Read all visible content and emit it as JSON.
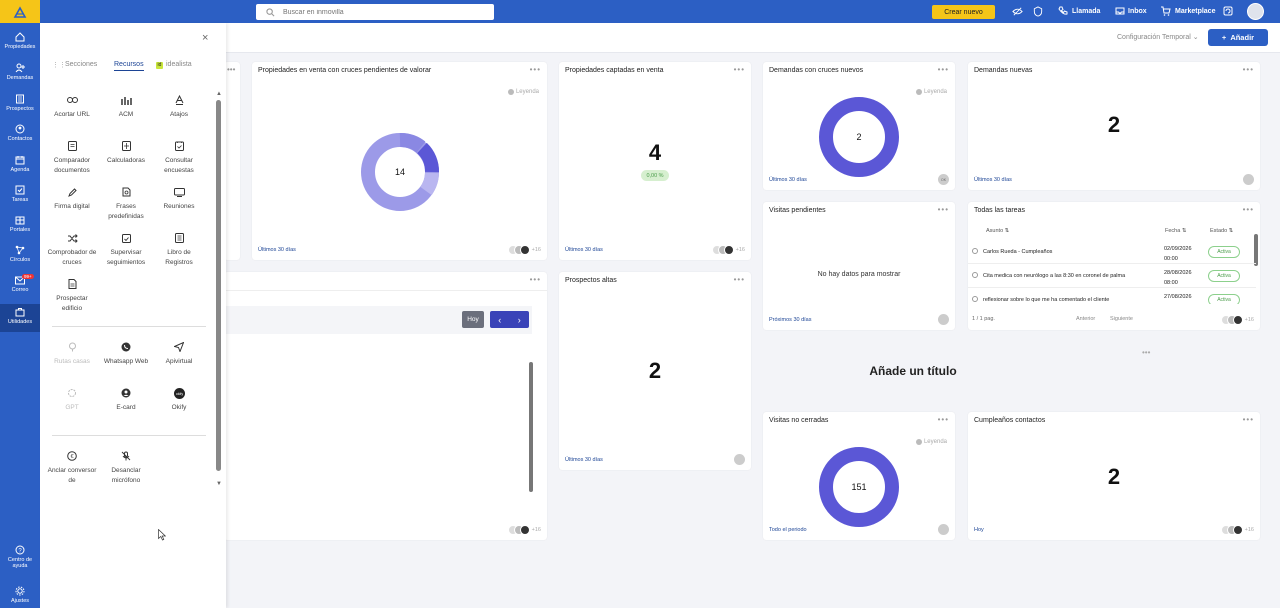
{
  "top": {
    "search_placeholder": "Buscar en inmovilla",
    "crear_label": "Crear nuevo",
    "llamada": "Llamada",
    "inbox": "Inbox",
    "marketplace": "Marketplace"
  },
  "sidebar": {
    "items": [
      {
        "label": "Propiedades"
      },
      {
        "label": "Demandas"
      },
      {
        "label": "Prospectos"
      },
      {
        "label": "Contactos"
      },
      {
        "label": "Agenda"
      },
      {
        "label": "Tareas"
      },
      {
        "label": "Portales"
      },
      {
        "label": "Círculos"
      },
      {
        "label": "Correo",
        "badge": "99+"
      },
      {
        "label": "Utilidades"
      }
    ],
    "help_label": "Centro de ayuda",
    "settings_label": "Ajustes"
  },
  "subheader": {
    "config_label": "Configuración Temporal",
    "add_label": "Añadir"
  },
  "panel": {
    "tabs": [
      "Secciones",
      "Recursos",
      "idealista"
    ],
    "tools_group1": [
      "Acortar URL",
      "ACM",
      "Atajos",
      "Comparador documentos",
      "Calculadoras",
      "Consultar encuestas",
      "Firma digital",
      "Frases predefinidas",
      "Reuniones",
      "Comprobador de cruces",
      "Supervisar seguimientos",
      "Libro de Registros",
      "Prospectar edificio"
    ],
    "tools_group2": [
      "Rutas casas",
      "Whatsapp Web",
      "Apivirtual",
      "GPT",
      "E-card",
      "Okify"
    ],
    "tools_group3": [
      "Anclar conversor de",
      "Desanclar micrófono"
    ]
  },
  "cards": {
    "cruces_pendientes": {
      "title": "Propiedades en venta con cruces pendientes de valorar",
      "center": "14",
      "legend": "Leyenda",
      "footer": "Últimos 30 días",
      "plus": "+16"
    },
    "captadas": {
      "title": "Propiedades captadas en venta",
      "value": "4",
      "pill": "0,00 %",
      "footer": "Últimos 30 días",
      "plus": "+16"
    },
    "demandas_cruces": {
      "title": "Demandas con cruces nuevos",
      "center": "2",
      "legend": "Leyenda",
      "footer": "Últimos 30 días",
      "mini": "OK"
    },
    "demandas_nuevas": {
      "title": "Demandas nuevas",
      "value": "2",
      "footer": "Últimos 30 días"
    },
    "visitas_pendientes": {
      "title": "Visitas pendientes",
      "empty": "No hay datos para mostrar",
      "footer": "Próximos 30 días"
    },
    "todas_tareas": {
      "title": "Todas las tareas",
      "headers": {
        "asunto": "Asunto",
        "fecha": "Fecha",
        "estado": "Estado"
      },
      "rows": [
        {
          "asunto": "Carlos Rueda - Cumpleaños",
          "fecha1": "02/09/2026",
          "fecha2": "00:00",
          "estado": "Activa"
        },
        {
          "asunto": "Cita medica con neurólogo a las 8:30 en coronel de palma",
          "fecha1": "28/08/2026",
          "fecha2": "08:00",
          "estado": "Activa"
        },
        {
          "asunto": "reflexionar sobre lo que me ha comentado el cliente",
          "fecha1": "27/08/2026",
          "fecha2": "",
          "estado": "Activa"
        }
      ],
      "pager": "1 / 1 pag.",
      "prev": "Anterior",
      "next": "Siguiente",
      "plus": "+16"
    },
    "prospectos_altas": {
      "title": "Prospectos altas",
      "value": "2",
      "footer": "Últimos 30 días"
    },
    "title_widget": {
      "text": "Añade un título"
    },
    "visitas_no_cerradas": {
      "title": "Visitas no cerradas",
      "center": "151",
      "legend": "Leyenda",
      "footer": "Todo el periodo"
    },
    "cumpleanos": {
      "title": "Cumpleaños contactos",
      "value": "2",
      "footer": "Hoy",
      "plus": "+16"
    },
    "agenda": {
      "hoy": "Hoy",
      "plus": "+16"
    },
    "partial": {
      "plus": "+16"
    }
  },
  "colors": {
    "brand": "#2c5fc4",
    "accent": "#f5c518",
    "donut": "#5b57d6",
    "donut_light": "#9c9ae8"
  }
}
